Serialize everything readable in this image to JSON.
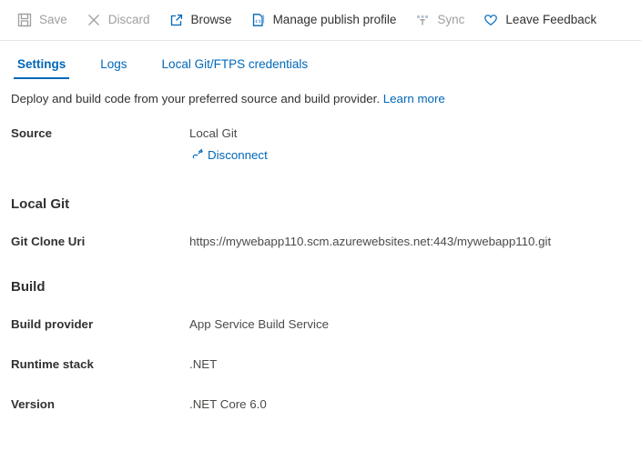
{
  "toolbar": {
    "items": [
      {
        "label": "Save",
        "icon": "save-icon",
        "enabled": false
      },
      {
        "label": "Discard",
        "icon": "discard-icon",
        "enabled": false
      },
      {
        "label": "Browse",
        "icon": "browse-icon",
        "enabled": true
      },
      {
        "label": "Manage publish profile",
        "icon": "publish-profile-icon",
        "enabled": true
      },
      {
        "label": "Sync",
        "icon": "sync-icon",
        "enabled": false
      },
      {
        "label": "Leave Feedback",
        "icon": "heart-icon",
        "enabled": true
      }
    ]
  },
  "tabs": [
    {
      "label": "Settings",
      "active": true
    },
    {
      "label": "Logs",
      "active": false
    },
    {
      "label": "Local Git/FTPS credentials",
      "active": false
    }
  ],
  "description": {
    "text": "Deploy and build code from your preferred source and build provider.",
    "link": "Learn more"
  },
  "source": {
    "label": "Source",
    "value": "Local Git",
    "disconnect_label": "Disconnect",
    "disconnect_icon": "disconnect-icon"
  },
  "local_git": {
    "heading": "Local Git",
    "clone_uri_label": "Git Clone Uri",
    "clone_uri_value": "https://mywebapp110.scm.azurewebsites.net:443/mywebapp110.git"
  },
  "build": {
    "heading": "Build",
    "rows": [
      {
        "label": "Build provider",
        "value": "App Service Build Service"
      },
      {
        "label": "Runtime stack",
        "value": ".NET"
      },
      {
        "label": "Version",
        "value": ".NET Core 6.0"
      }
    ]
  },
  "colors": {
    "accent": "#0067b8",
    "text": "#323130",
    "disabled": "#a19f9d",
    "value_text": "#4b4a49",
    "divider": "#e6e6e6"
  }
}
